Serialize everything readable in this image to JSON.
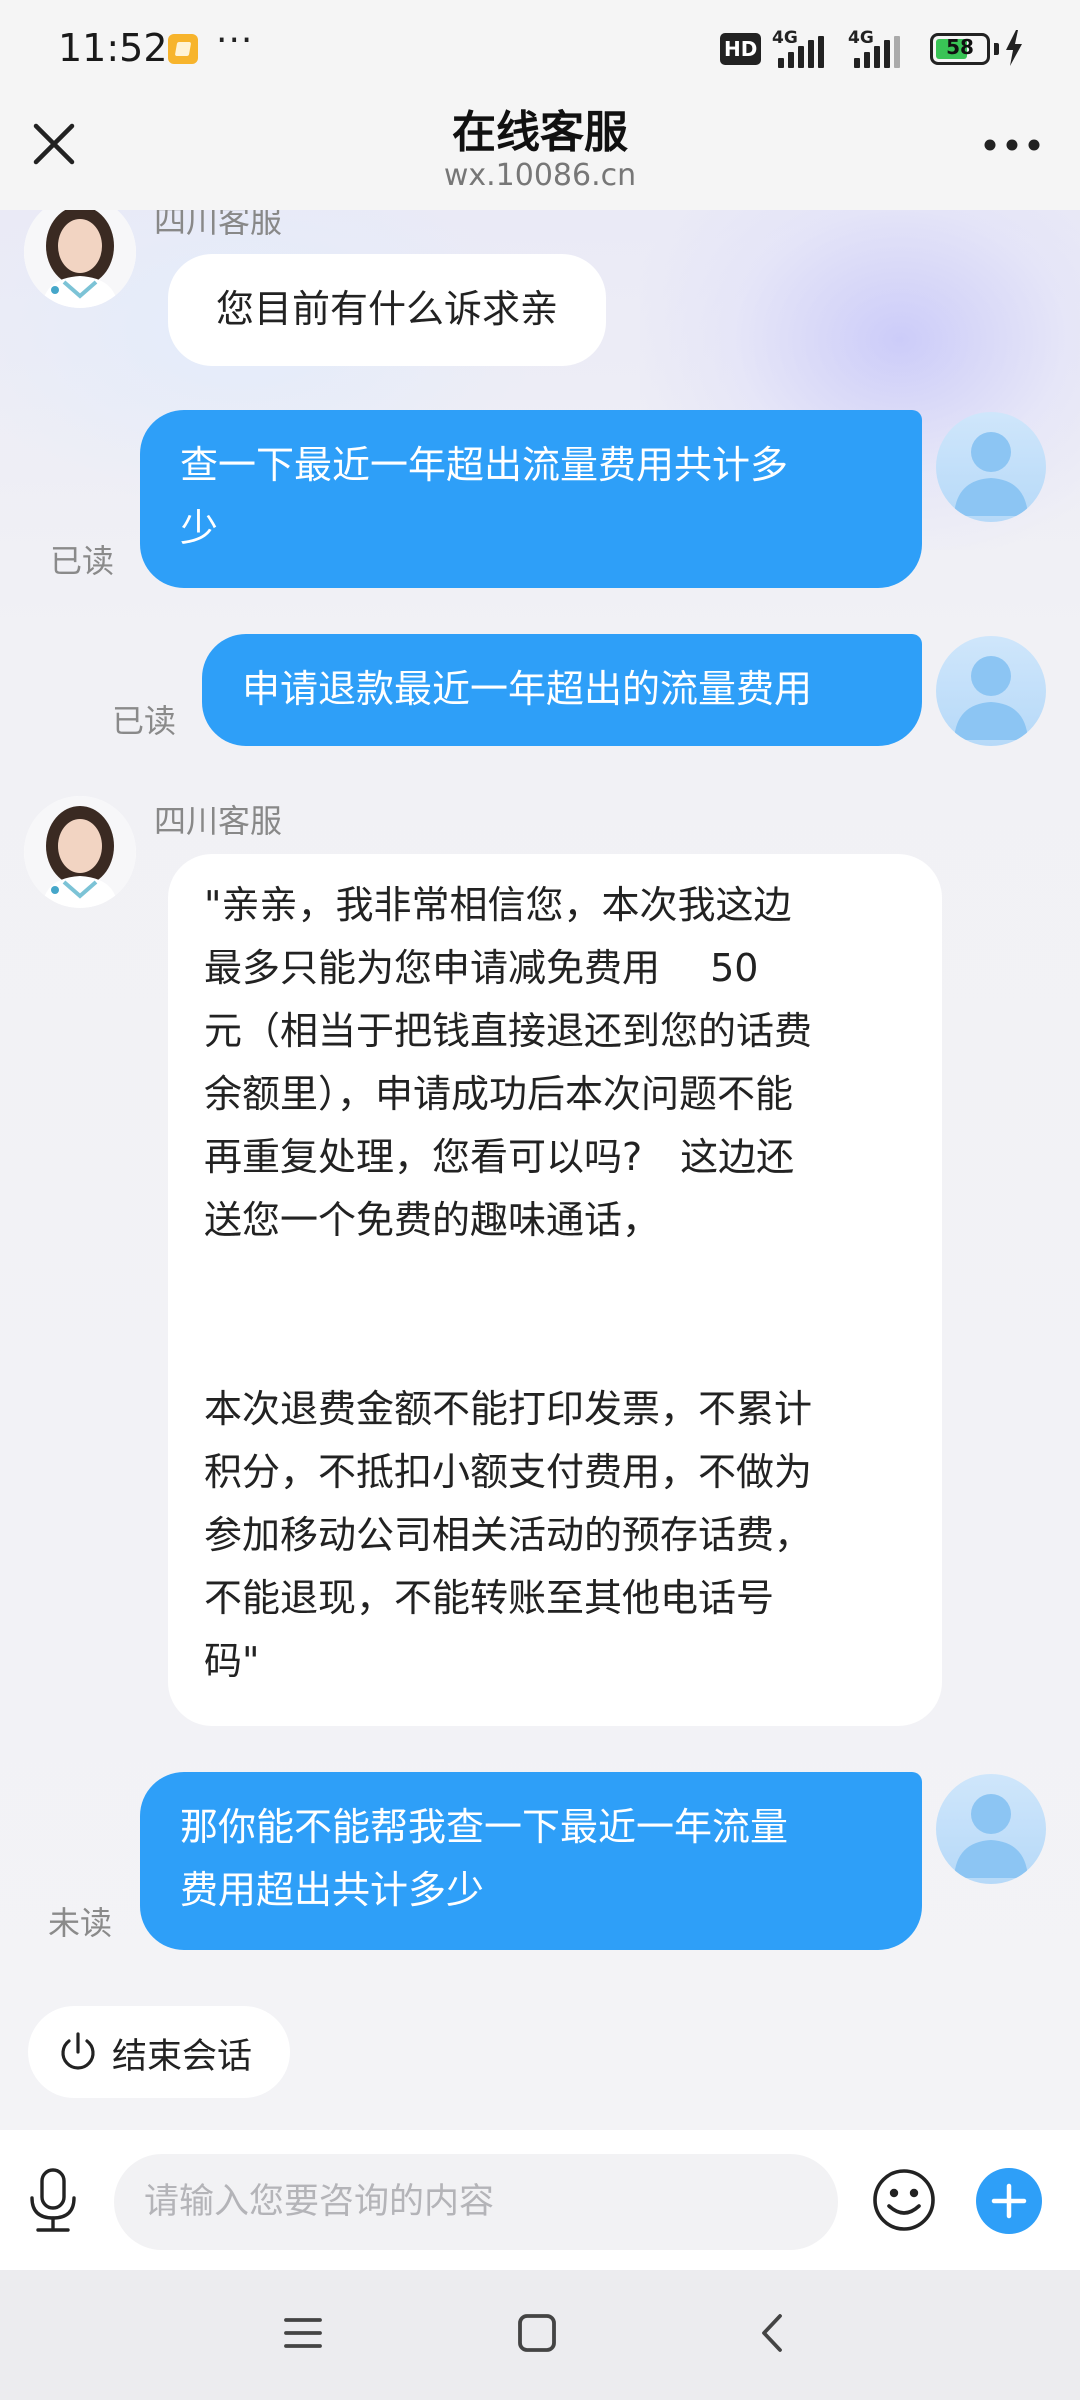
{
  "status_bar": {
    "time": "11:52",
    "hd_badge": "HD",
    "network_1": "4G",
    "network_2": "4G",
    "battery": "58"
  },
  "header": {
    "title": "在线客服",
    "url": "wx.10086.cn"
  },
  "agent": {
    "name": "四川客服"
  },
  "messages": [
    {
      "from": "agent",
      "text": "您目前有什么诉求亲"
    },
    {
      "from": "user",
      "lines": [
        "查一下最近一年超出流量费用共计多",
        "少"
      ],
      "status": "已读"
    },
    {
      "from": "user",
      "lines": [
        "申请退款最近一年超出的流量费用"
      ],
      "status": "已读"
    },
    {
      "from": "agent",
      "lines": [
        "\"亲亲，我非常相信您，本次我这边",
        "最多只能为您申请减免费用　 50",
        "元（相当于把钱直接退还到您的话费",
        "余额里），申请成功后本次问题不能",
        "再重复处理，您看可以吗?　这边还",
        "送您一个免费的趣味通话，",
        "",
        "",
        "本次退费金额不能打印发票，不累计",
        "积分，不抵扣小额支付费用，不做为",
        "参加移动公司相关活动的预存话费，",
        "不能退现，不能转账至其他电话号",
        "码\""
      ]
    },
    {
      "from": "user",
      "lines": [
        "那你能不能帮我查一下最近一年流量",
        "费用超出共计多少"
      ],
      "status": "未读"
    }
  ],
  "end_chat": {
    "label": "结束会话"
  },
  "input": {
    "placeholder": "请输入您要咨询的内容"
  },
  "colors": {
    "user_bubble": "#2e9ff8",
    "agent_bubble": "#ffffff",
    "background": "#f3f3f6",
    "battery": "#39c456"
  },
  "icons": [
    "close-icon",
    "more-icon",
    "microphone-icon",
    "emoji-icon",
    "plus-icon",
    "power-icon",
    "menu-icon",
    "home-icon",
    "back-icon"
  ]
}
